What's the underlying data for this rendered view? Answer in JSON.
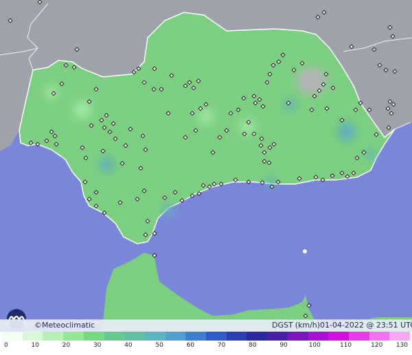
{
  "map": {
    "credit": "©Meteoclimatic",
    "variable": "DGST",
    "unit": "(km/h)",
    "timestamp": "01-04-2022 @ 23:51 UTC",
    "colors": {
      "sea": "#7b86d9",
      "land_outside": "#9ea3ab",
      "region_fill": "#7ccf80",
      "region_border": "#ffffff",
      "station_marker": "#1a1a1a"
    },
    "legend": {
      "ticks": [
        "0",
        "10",
        "20",
        "30",
        "40",
        "50",
        "60",
        "70",
        "80",
        "90",
        "100",
        "110",
        "120",
        "130"
      ],
      "colors": [
        "#f0fff0",
        "#d8f8d8",
        "#b6f0b6",
        "#93e693",
        "#76d981",
        "#66c98d",
        "#62bfa6",
        "#5ab5c0",
        "#4fa2d0",
        "#3f7fd0",
        "#2f5cc6",
        "#2a3fb5",
        "#2a2aa0",
        "#4a1fa8",
        "#7a16c0",
        "#a812d6",
        "#d40fe0",
        "#e83ae6",
        "#f072ee",
        "#f6a8f4"
      ]
    },
    "logo_icon": "meteoclimatic-logo-icon",
    "station_icon": "station-marker-icon"
  }
}
